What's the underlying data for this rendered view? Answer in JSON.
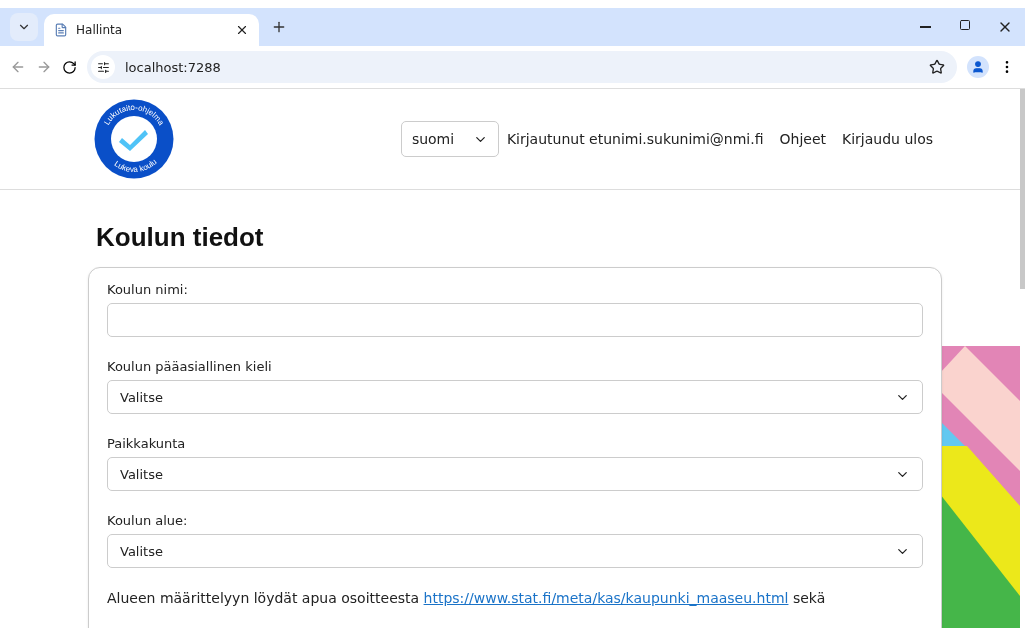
{
  "browser": {
    "tab_title": "Hallinta",
    "url": "localhost:7288"
  },
  "header": {
    "logo_top_text": "Lukutaito-ohjelma",
    "logo_bottom_text": "Lukeva koulu",
    "language": "suomi",
    "logged_in": "Kirjautunut etunimi.sukunimi@nmi.fi",
    "links": [
      "Ohjeet",
      "Kirjaudu ulos"
    ]
  },
  "page": {
    "title": "Koulun tiedot",
    "fields": [
      {
        "kind": "text",
        "label": "Koulun nimi:"
      },
      {
        "kind": "select",
        "label": "Koulun pääasiallinen kieli",
        "value": "Valitse"
      },
      {
        "kind": "select",
        "label": "Paikkakunta",
        "value": "Valitse"
      },
      {
        "kind": "select",
        "label": "Koulun alue:",
        "value": "Valitse"
      }
    ],
    "help_text": {
      "before": "Alueen määrittelyyn löydät apua osoitteesta",
      "link": "https://www.stat.fi/meta/kas/kaupunki_maaseu.html",
      "after": "sekä"
    }
  }
}
